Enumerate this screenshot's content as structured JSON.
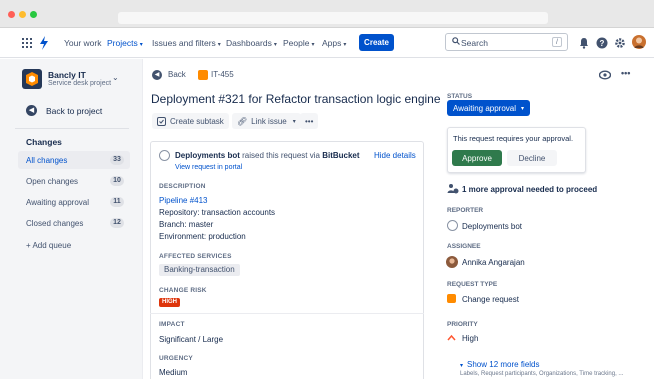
{
  "nav": {
    "your_work": "Your work",
    "projects": "Projects",
    "issues": "Issues and filters",
    "dashboards": "Dashboards",
    "people": "People",
    "apps": "Apps",
    "create": "Create",
    "search_placeholder": "Search",
    "search_shortcut": "/"
  },
  "sidebar": {
    "project_name": "Bancly IT",
    "project_type": "Service desk project",
    "back": "Back to project",
    "heading": "Changes",
    "queues": [
      {
        "label": "All changes",
        "count": "33",
        "selected": true
      },
      {
        "label": "Open changes",
        "count": "10",
        "selected": false
      },
      {
        "label": "Awaiting approval",
        "count": "11",
        "selected": false
      },
      {
        "label": "Closed changes",
        "count": "12",
        "selected": false
      }
    ],
    "add_queue": "+ Add queue"
  },
  "breadcrumb": {
    "back": "Back",
    "issue_key": "IT-455"
  },
  "issue": {
    "title": "Deployment #321 for Refactor transaction logic engine",
    "actions": {
      "create_subtask": "Create subtask",
      "link_issue": "Link issue",
      "more": "•••"
    },
    "reporter_name": "Deployments bot",
    "raised_text": "raised this request via",
    "raised_source": "BitBucket",
    "hide_details": "Hide details",
    "view_portal": "View request in portal",
    "description_label": "DESCRIPTION",
    "description": {
      "link": "Pipeline #413",
      "line1": "Repository: transaction accounts",
      "line2": "Branch: master",
      "line3": "Environment: production"
    },
    "affected_label": "AFFECTED SERVICES",
    "affected_service": "Banking-transaction",
    "risk_label": "CHANGE RISK",
    "risk_value": "HIGH",
    "impact_label": "IMPACT",
    "impact_value": "Significant / Large",
    "urgency_label": "URGENCY",
    "urgency_value": "Medium"
  },
  "panel": {
    "status_label": "STATUS",
    "status_value": "Awaiting approval",
    "approval_prompt": "This request requires your approval.",
    "approve": "Approve",
    "decline": "Decline",
    "approvals_needed": "1 more approval needed to proceed",
    "reporter_label": "REPORTER",
    "reporter_value": "Deployments bot",
    "assignee_label": "ASSIGNEE",
    "assignee_value": "Annika Angarajan",
    "request_type_label": "REQUEST TYPE",
    "request_type_value": "Change request",
    "priority_label": "PRIORITY",
    "priority_value": "High",
    "show_more": "Show 12 more fields",
    "show_more_sub": "Labels, Request participants, Organizations, Time tracking, ..."
  },
  "colors": {
    "primary": "#0052cc",
    "approve": "#2f7a4c",
    "risk": "#de350b",
    "request_type": "#ff8b00"
  }
}
